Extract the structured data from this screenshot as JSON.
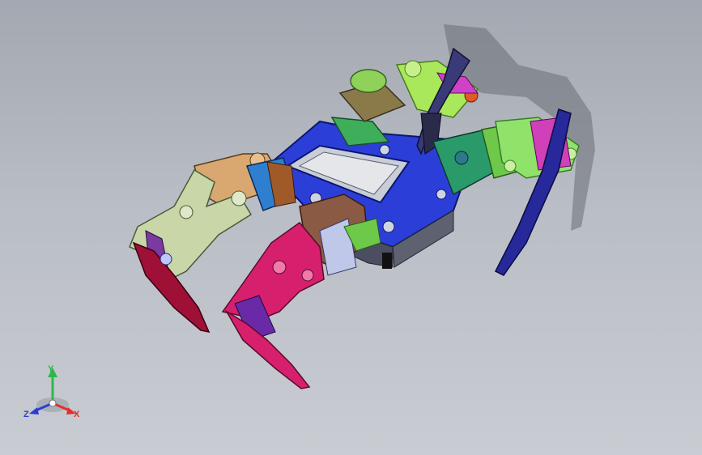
{
  "viewport": {
    "background_top": "#a3a8b1",
    "background_bottom": "#c9ccd2"
  },
  "model": {
    "part_colors": {
      "body_frame": "#2b3fd8",
      "front_left_leg": "#c8d6a8",
      "front_left_foot": "#9e1036",
      "front_right_leg": "#d6206e",
      "rear_left_leg": "#a8e85a",
      "rear_right_leg": "#8fe36a",
      "rear_feet": "#27299a",
      "servo_brown": "#8a5a44",
      "servo_blue": "#2f7fd0",
      "servo_green": "#3fae5a"
    }
  },
  "triad": {
    "y_label": "Y",
    "x_label": "X",
    "z_label": "Z",
    "y_color": "#2fb84a",
    "x_color": "#e03030",
    "z_color": "#2a3fd0"
  }
}
